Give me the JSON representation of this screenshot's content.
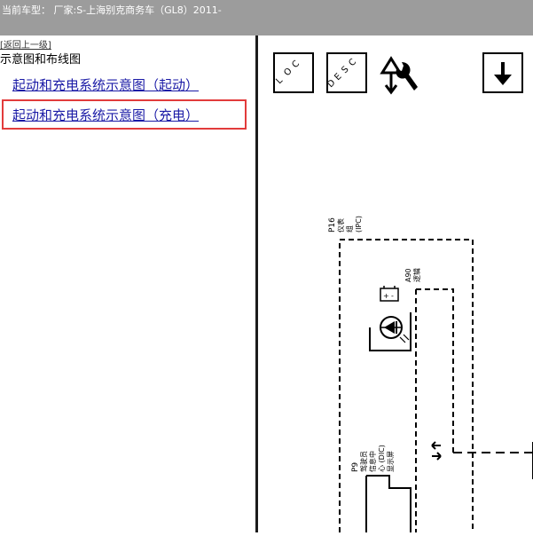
{
  "header": {
    "current_vehicle_text": "当前车型： 厂家:S-上海别克商务车（GL8）2011-"
  },
  "sidebar": {
    "back_link": "[返回上一级]",
    "section_title": "示意图和布线图",
    "links": [
      {
        "label": "起动和充电系统示意图（起动）"
      },
      {
        "label": "起动和充电系统示意图（充电）"
      }
    ]
  },
  "diagram": {
    "toolbar": {
      "loc_label": "LOC",
      "desc_label": "DESC"
    },
    "component_ipc": {
      "code": "P16",
      "name_line1": "仪表",
      "name_line2": "组",
      "name_line3": "(IPC)"
    },
    "component_a90": {
      "code": "A90",
      "name": "逻辑"
    },
    "component_dic": {
      "code": "P9",
      "name_line1": "驾驶员",
      "name_line2": "信息中",
      "name_line3": "心 (DIC)",
      "name_line4": "显示屏"
    }
  }
}
